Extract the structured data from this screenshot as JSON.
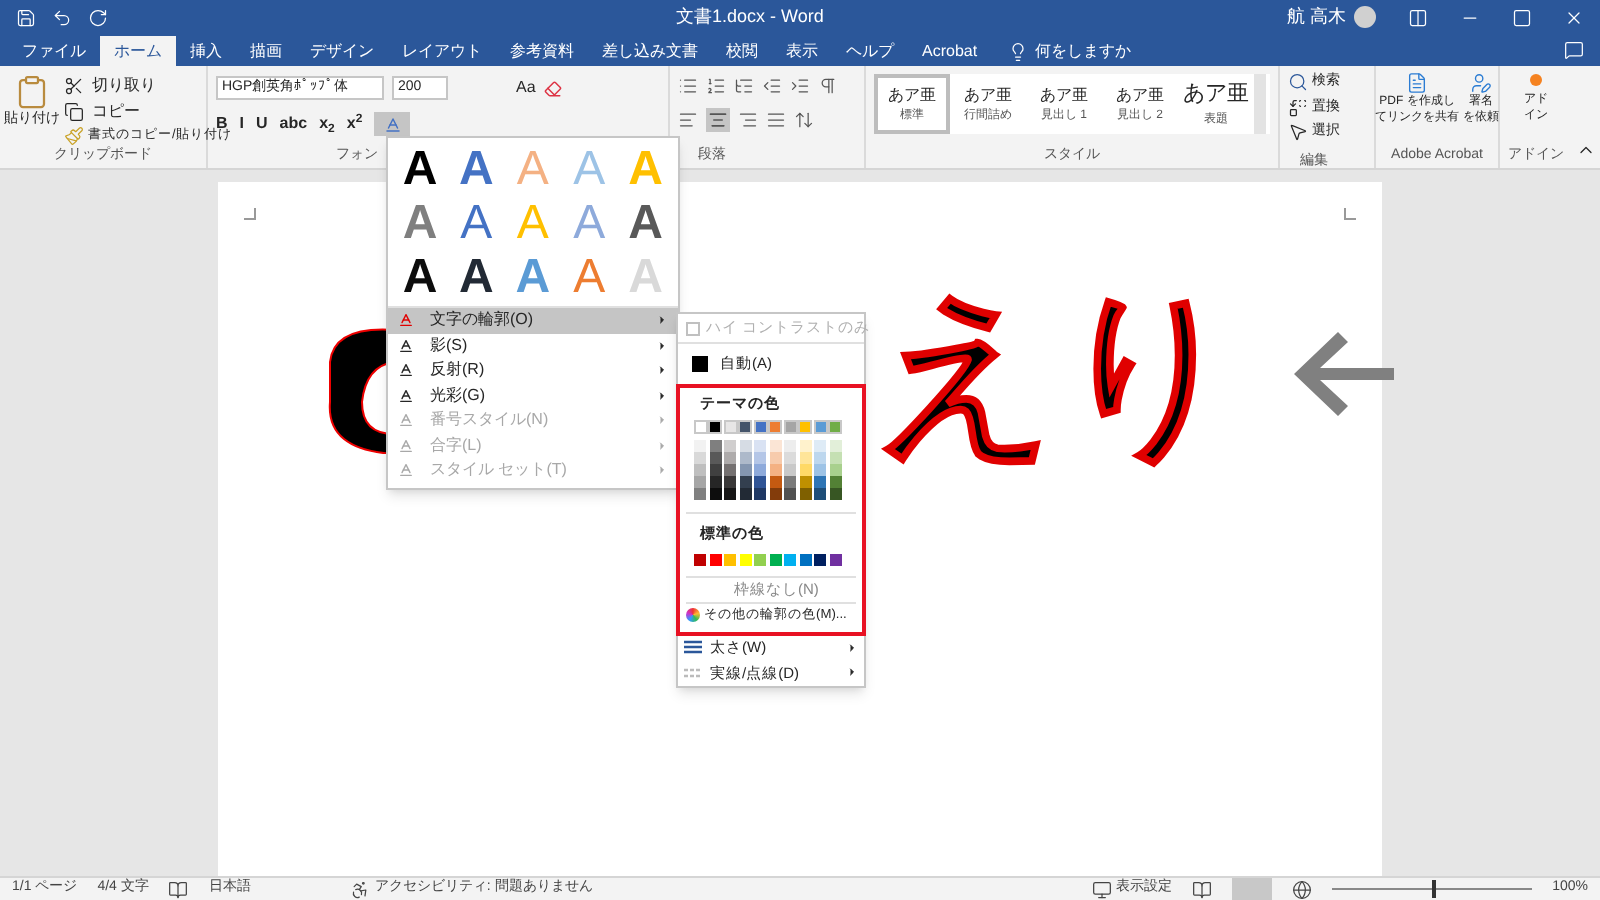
{
  "window": {
    "title": "文書1.docx  -  Word",
    "user": "航 高木"
  },
  "tabs": [
    {
      "label": "ファイル",
      "selected": false
    },
    {
      "label": "ホーム",
      "selected": true
    },
    {
      "label": "挿入",
      "selected": false
    },
    {
      "label": "描画",
      "selected": false
    },
    {
      "label": "デザイン",
      "selected": false
    },
    {
      "label": "レイアウト",
      "selected": false
    },
    {
      "label": "参考資料",
      "selected": false
    },
    {
      "label": "差し込み文書",
      "selected": false
    },
    {
      "label": "校閲",
      "selected": false
    },
    {
      "label": "表示",
      "selected": false
    },
    {
      "label": "ヘルプ",
      "selected": false
    },
    {
      "label": "Acrobat",
      "selected": false
    }
  ],
  "tell_me": "何をしますか",
  "ribbon": {
    "clipboard": {
      "paste": "貼り付け",
      "cut": "切り取り",
      "copy": "コピー",
      "format_painter": "書式のコピー/貼り付け",
      "label": "クリップボード"
    },
    "font": {
      "name": "HGP創英角ﾎﾟｯﾌﾟ体",
      "size": "200",
      "case_button": "Aa",
      "format_buttons": [
        "B",
        "I",
        "U",
        "abc",
        "x$_{2}$",
        "x$^{2}$"
      ],
      "label": "フォン"
    },
    "paragraph": {
      "label": "段落"
    },
    "styles": {
      "items": [
        {
          "sample": "あア亜",
          "name": "標準",
          "selected": true
        },
        {
          "sample": "あア亜",
          "name": "行間詰め",
          "selected": false
        },
        {
          "sample": "あア亜",
          "name": "見出し 1",
          "selected": false
        },
        {
          "sample": "あア亜",
          "name": "見出し 2",
          "selected": false
        },
        {
          "sample": "あア亜",
          "name": "表題",
          "selected": false
        }
      ],
      "label": "スタイル"
    },
    "editing": {
      "find": "検索",
      "replace": "置換",
      "select": "選択",
      "label": "編集"
    },
    "acrobat": {
      "create_pdf": [
        "PDF を作成し",
        "てリンクを共有"
      ],
      "signature": [
        "署名",
        "を依頼"
      ],
      "label": "Adobe Acrobat"
    },
    "addin": {
      "button": [
        "アド",
        "イン"
      ],
      "label": "アドイン"
    }
  },
  "document": {
    "text": "えり"
  },
  "text_effects_menu": {
    "gallery": [
      {
        "text": "A",
        "kind": "fill",
        "color": "#000000"
      },
      {
        "text": "A",
        "kind": "fill",
        "color": "#4472c4"
      },
      {
        "text": "A",
        "kind": "outline",
        "color": "#f4b183"
      },
      {
        "text": "A",
        "kind": "outline",
        "color": "#9dc3e6"
      },
      {
        "text": "A",
        "kind": "fill",
        "color": "#ffc000"
      },
      {
        "text": "A",
        "kind": "fill",
        "color": "#7f7f7f"
      },
      {
        "text": "A",
        "kind": "outline",
        "color": "#4472c4"
      },
      {
        "text": "A",
        "kind": "outline",
        "color": "#ffc000"
      },
      {
        "text": "A",
        "kind": "outline",
        "color": "#8eaadb"
      },
      {
        "text": "A",
        "kind": "fill",
        "color": "#595959"
      },
      {
        "text": "A",
        "kind": "fill",
        "color": "#0d0d0d"
      },
      {
        "text": "A",
        "kind": "fill",
        "color": "#222a35"
      },
      {
        "text": "A",
        "kind": "fill",
        "color": "#5b9bd5"
      },
      {
        "text": "A",
        "kind": "outline",
        "color": "#ed7d31"
      },
      {
        "text": "A",
        "kind": "fill",
        "color": "#d9d9d9"
      }
    ],
    "items": [
      {
        "label": "文字の輪郭(O)",
        "selected": true,
        "disabled": false
      },
      {
        "label": "影(S)",
        "selected": false,
        "disabled": false
      },
      {
        "label": "反射(R)",
        "selected": false,
        "disabled": false
      },
      {
        "label": "光彩(G)",
        "selected": false,
        "disabled": false
      },
      {
        "label": "番号スタイル(N)",
        "selected": false,
        "disabled": true
      },
      {
        "label": "合字(L)",
        "selected": false,
        "disabled": true
      },
      {
        "label": "スタイル セット(T)",
        "selected": false,
        "disabled": true
      }
    ]
  },
  "outline_submenu": {
    "high_contrast": {
      "label": "ハイ コントラストのみ",
      "checked": false,
      "disabled": true
    },
    "automatic": "自動(A)",
    "theme_heading": "テーマの色",
    "theme_colors": [
      {
        "color": "#ffffff",
        "shades": [
          {
            "color": "#f2f2f2"
          },
          {
            "color": "#d9d9d9"
          },
          {
            "color": "#bfbfbf"
          },
          {
            "color": "#a6a6a6"
          },
          {
            "color": "#808080"
          }
        ]
      },
      {
        "color": "#000000",
        "shades": [
          {
            "color": "#7f7f7f"
          },
          {
            "color": "#595959"
          },
          {
            "color": "#404040"
          },
          {
            "color": "#262626"
          },
          {
            "color": "#0d0d0d"
          }
        ]
      },
      {
        "color": "#e7e6e6",
        "shades": [
          {
            "color": "#d0cece"
          },
          {
            "color": "#aeabab"
          },
          {
            "color": "#757171"
          },
          {
            "color": "#3a3838"
          },
          {
            "color": "#171616"
          }
        ]
      },
      {
        "color": "#44546a",
        "shades": [
          {
            "color": "#d6dce4"
          },
          {
            "color": "#adb9ca"
          },
          {
            "color": "#8496b0"
          },
          {
            "color": "#333f4f"
          },
          {
            "color": "#222a35"
          }
        ]
      },
      {
        "color": "#4472c4",
        "shades": [
          {
            "color": "#d9e2f3"
          },
          {
            "color": "#b4c6e7"
          },
          {
            "color": "#8eaadb"
          },
          {
            "color": "#2f5496"
          },
          {
            "color": "#1f3864"
          }
        ]
      },
      {
        "color": "#ed7d31",
        "shades": [
          {
            "color": "#fbe5d5"
          },
          {
            "color": "#f7cbac"
          },
          {
            "color": "#f4b183"
          },
          {
            "color": "#c55a11"
          },
          {
            "color": "#833c0b"
          }
        ]
      },
      {
        "color": "#a5a5a5",
        "shades": [
          {
            "color": "#ededed"
          },
          {
            "color": "#dbdbdb"
          },
          {
            "color": "#c9c9c9"
          },
          {
            "color": "#7b7b7b"
          },
          {
            "color": "#525252"
          }
        ]
      },
      {
        "color": "#ffc000",
        "shades": [
          {
            "color": "#fff2cc"
          },
          {
            "color": "#ffe599"
          },
          {
            "color": "#ffd966"
          },
          {
            "color": "#bf9000"
          },
          {
            "color": "#7f6000"
          }
        ]
      },
      {
        "color": "#5b9bd5",
        "shades": [
          {
            "color": "#deebf6"
          },
          {
            "color": "#bdd7ee"
          },
          {
            "color": "#9dc3e6"
          },
          {
            "color": "#2e75b5"
          },
          {
            "color": "#1e4e79"
          }
        ]
      },
      {
        "color": "#70ad47",
        "shades": [
          {
            "color": "#e2efd9"
          },
          {
            "color": "#c5e0b3"
          },
          {
            "color": "#a8d08d"
          },
          {
            "color": "#538135"
          },
          {
            "color": "#375623"
          }
        ]
      }
    ],
    "standard_heading": "標準の色",
    "standard_colors": [
      {
        "color": "#c00000"
      },
      {
        "color": "#ff0000"
      },
      {
        "color": "#ffc000"
      },
      {
        "color": "#ffff00"
      },
      {
        "color": "#92d050"
      },
      {
        "color": "#00b050"
      },
      {
        "color": "#00b0f0"
      },
      {
        "color": "#0070c0"
      },
      {
        "color": "#002060"
      },
      {
        "color": "#7030a0"
      }
    ],
    "no_outline": "枠線なし(N)",
    "more_colors": "その他の輪郭の色(M)...",
    "items": [
      {
        "label": "太さ(W)",
        "kind": "weight"
      },
      {
        "label": "実線/点線(D)",
        "kind": "dash"
      }
    ]
  },
  "status_bar": {
    "page": "1/1 ページ",
    "words": "4/4 文字",
    "language": "日本語",
    "accessibility": "アクセシビリティ: 問題ありません",
    "display_settings": "表示設定",
    "zoom": "100%",
    "zoom_slider": {
      "level": 0.5
    }
  }
}
